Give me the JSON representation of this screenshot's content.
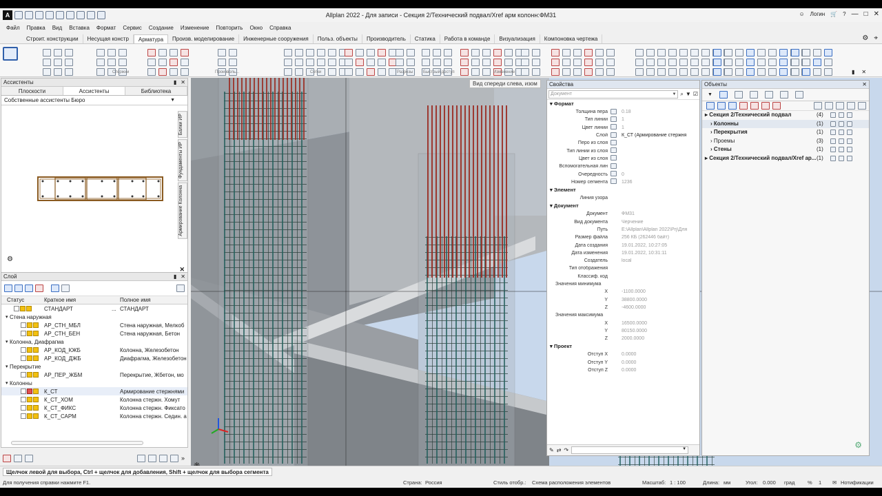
{
  "window": {
    "title": "Allplan 2022 - Для записи - Секция 2/Технический подвал/Xref арм колонн:ФМ31",
    "login": "Логин",
    "logo": "A"
  },
  "menu": [
    "Файл",
    "Правка",
    "Вид",
    "Вставка",
    "Формат",
    "Сервис",
    "Создание",
    "Изменение",
    "Повторить",
    "Окно",
    "Справка"
  ],
  "tabs": [
    {
      "label": "Строит. конструкции",
      "active": false
    },
    {
      "label": "Несущая констр",
      "active": false
    },
    {
      "label": "Арматура",
      "active": true
    },
    {
      "label": "Произв. моделирование",
      "active": false
    },
    {
      "label": "Инженерные сооружения",
      "active": false
    },
    {
      "label": "Польз. объекты",
      "active": false
    },
    {
      "label": "Производитель",
      "active": false
    },
    {
      "label": "Статика",
      "active": false
    },
    {
      "label": "Работа в команде",
      "active": false
    },
    {
      "label": "Визуализация",
      "active": false
    },
    {
      "label": "Компоновка чертежа",
      "active": false
    }
  ],
  "ribbon_groups": [
    "Стержни",
    "Произволь...",
    "Сетки",
    "Разрезы",
    "Быстрый доступ",
    "Изменение"
  ],
  "assistants": {
    "header": "Ассистенты",
    "tabs": [
      "Плоскости",
      "Ассистенты",
      "Библиотека"
    ],
    "active_tab": 1,
    "dropdown": "Собственные ассистенты Бюро",
    "side_tabs": [
      "Балки ИР",
      "Фундаменты ИР",
      "Армирование Колонна"
    ]
  },
  "layers": {
    "header": "Слой",
    "columns": [
      "Статус",
      "Краткое имя",
      "Полное имя"
    ],
    "rows": [
      {
        "type": "item",
        "short": "СТАНДАРТ",
        "full": "СТАНДАРТ",
        "dots": "...",
        "indent": false
      },
      {
        "type": "group",
        "label": "Стена наружная"
      },
      {
        "type": "item",
        "short": "АР_СТН_МБЛ",
        "full": "Стена наружная, Мелкоб",
        "indent": true
      },
      {
        "type": "item",
        "short": "АР_СТН_БЕН",
        "full": "Стена наружная, Бетон",
        "indent": true
      },
      {
        "type": "group",
        "label": "Колонна, Диафрагма"
      },
      {
        "type": "item",
        "short": "АР_КОД_КЖБ",
        "full": "Колонна, Железобетон",
        "indent": true
      },
      {
        "type": "item",
        "short": "АР_КОД_ДЖБ",
        "full": "Диафрагма, Железобетон",
        "indent": true
      },
      {
        "type": "group",
        "label": "Перекрытие"
      },
      {
        "type": "item",
        "short": "АР_ПЕР_ЖБМ",
        "full": "Перекрытие, Жбетон, мо",
        "indent": true
      },
      {
        "type": "group",
        "label": "Колонны"
      },
      {
        "type": "item",
        "short": "К_СТ",
        "full": "Армирование стержнями",
        "indent": true,
        "selected": true
      },
      {
        "type": "item",
        "short": "К_СТ_ХОМ",
        "full": "Колонна стержн. Хомут",
        "indent": true
      },
      {
        "type": "item",
        "short": "К_СТ_ФИКС",
        "full": "Колонна стержн. Фиксато",
        "indent": true
      },
      {
        "type": "item",
        "short": "К_СТ_САРМ",
        "full": "Колонна стержн. Седин. а",
        "indent": true
      }
    ]
  },
  "viewport": {
    "tooltip": "Вид спереди слева, изом"
  },
  "properties": {
    "header": "Свойства",
    "doc_placeholder": "Документ",
    "sections": [
      {
        "title": "Формат",
        "rows": [
          {
            "k": "Толщина пера",
            "v": "0.18"
          },
          {
            "k": "Тип линии",
            "v": "1"
          },
          {
            "k": "Цвет линии",
            "v": "1"
          },
          {
            "k": "Слой",
            "v": "К_СТ (Армирование стержня",
            "dark": true
          },
          {
            "k": "Перо из слоя",
            "v": ""
          },
          {
            "k": "Тип линии из слоя",
            "v": ""
          },
          {
            "k": "Цвет из слоя",
            "v": ""
          },
          {
            "k": "Вспомогательная лин",
            "v": ""
          },
          {
            "k": "Очередность",
            "v": "0"
          },
          {
            "k": "Номер сегмента",
            "v": "1236"
          }
        ]
      },
      {
        "title": "Элемент",
        "rows": [
          {
            "k": "Линия узора",
            "v": ""
          }
        ]
      },
      {
        "title": "Документ",
        "rows": [
          {
            "k": "Документ",
            "v": "ФМ31"
          },
          {
            "k": "Вид документа",
            "v": "Черчение"
          },
          {
            "k": "Путь",
            "v": "E:\\Allplan\\Allplan 2022\\Prj\\Для"
          },
          {
            "k": "Размер файла",
            "v": "256 КБ (262446 байт)"
          },
          {
            "k": "Дата создания",
            "v": "19.01.2022, 10:27:05"
          },
          {
            "k": "Дата изменения",
            "v": "19.01.2022, 10:31:11"
          },
          {
            "k": "Создатель",
            "v": "local"
          },
          {
            "k": "Тип отображения",
            "v": ""
          },
          {
            "k": "Классиф. код",
            "v": ""
          },
          {
            "k": "Значения минимума",
            "v": "",
            "sub": true
          },
          {
            "k": "X",
            "v": "-1100.0000"
          },
          {
            "k": "Y",
            "v": "38800.0000"
          },
          {
            "k": "Z",
            "v": "-4600.0000"
          },
          {
            "k": "Значения максимума",
            "v": "",
            "sub": true
          },
          {
            "k": "X",
            "v": "16500.0000"
          },
          {
            "k": "Y",
            "v": "80150.0000"
          },
          {
            "k": "Z",
            "v": "2000.0000"
          }
        ]
      },
      {
        "title": "Проект",
        "rows": [
          {
            "k": "Отступ X",
            "v": "0.0000"
          },
          {
            "k": "Отступ Y",
            "v": "0.0000"
          },
          {
            "k": "Отступ Z",
            "v": "0.0000"
          }
        ]
      }
    ]
  },
  "objects": {
    "header": "Объекты",
    "rows": [
      {
        "label": "Секция 2/Технический подвал",
        "count": "(4)",
        "bold": true,
        "level": 0
      },
      {
        "label": "Колонны",
        "count": "(1)",
        "bold": true,
        "level": 1,
        "selected": true
      },
      {
        "label": "Перекрытия",
        "count": "(1)",
        "bold": true,
        "level": 1
      },
      {
        "label": "Проемы",
        "count": "(3)",
        "bold": false,
        "level": 1
      },
      {
        "label": "Стены",
        "count": "(1)",
        "bold": true,
        "level": 1
      },
      {
        "label": "Секция 2/Технический подвал/Xref ар...",
        "count": "(1)",
        "bold": true,
        "level": 0
      }
    ]
  },
  "status": {
    "hint": "Щелчок левой для выбора, Ctrl + щелчок для добавления, Shift + щелчок для выбора сегмента",
    "help": "Для получения справки нажмите F1.",
    "country_label": "Страна:",
    "country": "Россия",
    "style_label": "Стиль отобр.:",
    "style": "Схема расположения элементов",
    "scale_label": "Масштаб:",
    "scale": "1 : 100",
    "length_label": "Длина:",
    "length": "мм",
    "angle_label": "Угол:",
    "angle": "0.000",
    "angle_unit": "град",
    "pct": "%",
    "pct_val": "1",
    "notifications": "Нотификации"
  }
}
